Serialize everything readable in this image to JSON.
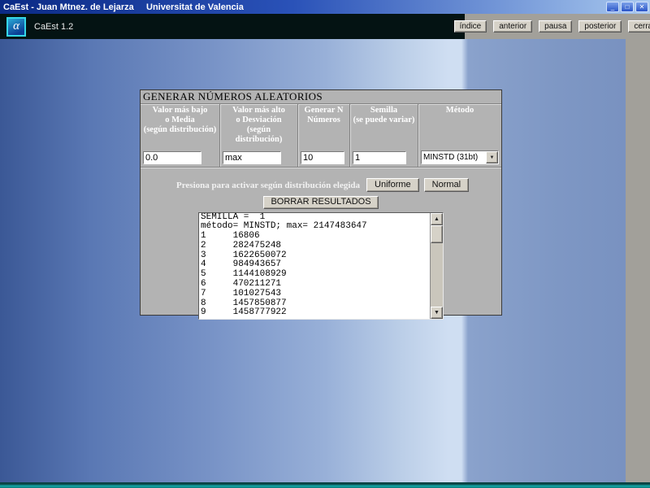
{
  "window": {
    "title": "CaEst - Juan Mtnez. de Lejarza",
    "subtitle": "Universitat de Valencia",
    "controls": {
      "minimize": "_",
      "maximize": "□",
      "close": "✕"
    }
  },
  "toolbar": {
    "logo_glyph": "α",
    "app_version": "CaEst 1.2",
    "nav": [
      "índice",
      "anterior",
      "pausa",
      "posterior",
      "cerrar"
    ]
  },
  "dialog": {
    "title": "GENERAR NÚMEROS ALEATORIOS",
    "fields": [
      {
        "header": "Valor más bajo\no Media\n(según distribución)",
        "value": "0.0"
      },
      {
        "header": "Valor más alto\no Desviación\n(según distribución)",
        "value": "max"
      },
      {
        "header": "Generar N\nNúmeros",
        "value": "10"
      },
      {
        "header": "Semilla\n(se puede variar)",
        "value": "1"
      },
      {
        "header": "Método",
        "value": "MINSTD (31bt)"
      }
    ],
    "combo_arrow": "▼",
    "activate_label": "Presiona para activar según distribución elegida",
    "buttons": {
      "uniform": "Uniforme",
      "normal": "Normal",
      "clear": "BORRAR RESULTADOS"
    },
    "results_lines": [
      "SEMILLA =  1",
      "método= MINSTD; max= 2147483647",
      "1     16806",
      "2     282475248",
      "3     1622650072",
      "4     984943657",
      "5     1144108929",
      "6     470211271",
      "7     101027543",
      "8     1457850877",
      "9     1458777922"
    ],
    "scroll_icons": {
      "up": "▲",
      "down": "▼"
    }
  },
  "colors": {
    "titlebar_left": "#0b2a85",
    "titlebar_right": "#a8c8ee",
    "logo_cyan": "#35d8e8",
    "header_dark": "#041313",
    "bottombar_teal": "#14a8a8",
    "dialog_gray": "#b3b3b3"
  }
}
